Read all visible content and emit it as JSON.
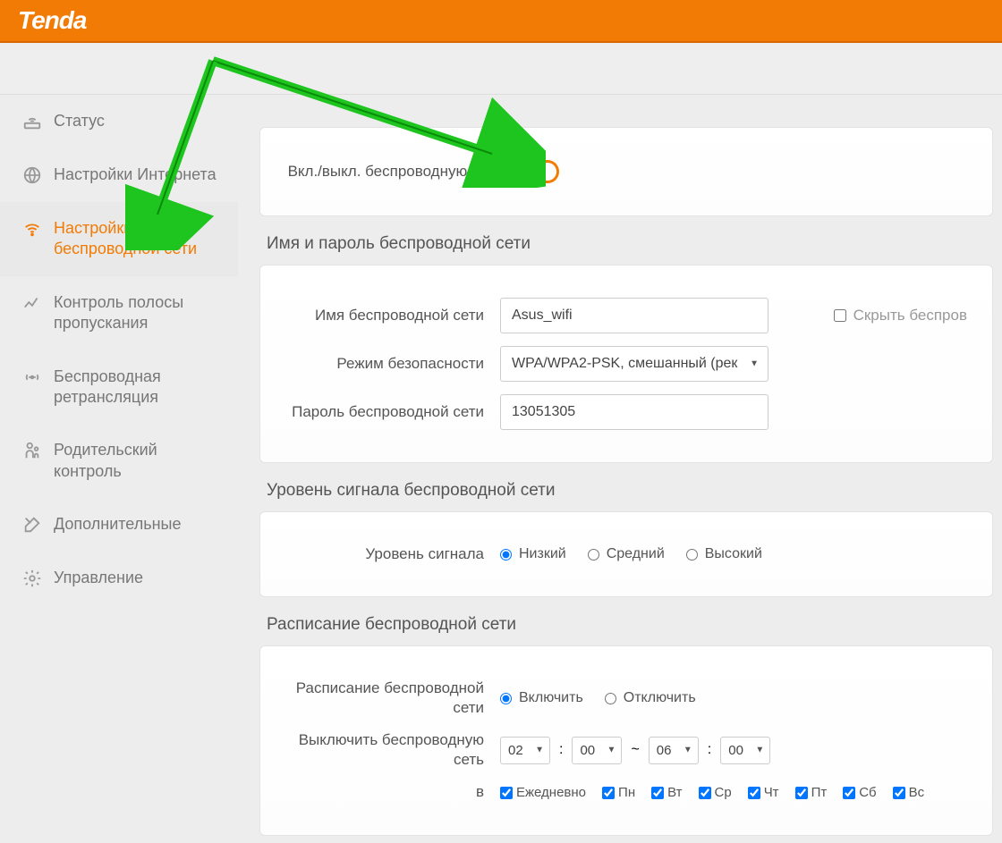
{
  "brand": "Tenda",
  "sidebar": {
    "items": [
      {
        "label": "Статус"
      },
      {
        "label": "Настройки Интернета"
      },
      {
        "label": "Настройки беспроводной сети"
      },
      {
        "label": "Контроль полосы пропускания"
      },
      {
        "label": "Беспроводная ретрансляция"
      },
      {
        "label": "Родительский контроль"
      },
      {
        "label": "Дополнительные"
      },
      {
        "label": "Управление"
      }
    ]
  },
  "sections": {
    "wireless_toggle_label": "Вкл./выкл. беспроводную сеть",
    "name_password_title": "Имя и пароль беспроводной сети",
    "ssid_label": "Имя беспроводной сети",
    "ssid_value": "Asus_wifi",
    "hide_ssid_label": "Скрыть беспров",
    "security_label": "Режим безопасности",
    "security_value": "WPA/WPA2-PSK, смешанный (рек",
    "password_label": "Пароль беспроводной сети",
    "password_value": "13051305",
    "signal_title": "Уровень сигнала беспроводной сети",
    "signal_label": "Уровень сигнала",
    "signal_low": "Низкий",
    "signal_med": "Средний",
    "signal_high": "Высокий",
    "schedule_title": "Расписание беспроводной сети",
    "schedule_label": "Расписание беспроводной сети",
    "enable": "Включить",
    "disable": "Отключить",
    "shutdown_label": "Выключить беспроводную сеть",
    "time_h1": "02",
    "time_m1": "00",
    "time_sep1": ":",
    "time_range": "~",
    "time_h2": "06",
    "time_m2": "00",
    "time_sep2": ":",
    "days_label": "в",
    "days": {
      "daily": "Ежедневно",
      "mon": "Пн",
      "tue": "Вт",
      "wed": "Ср",
      "thu": "Чт",
      "fri": "Пт",
      "sat": "Сб",
      "sun": "Вс"
    }
  }
}
